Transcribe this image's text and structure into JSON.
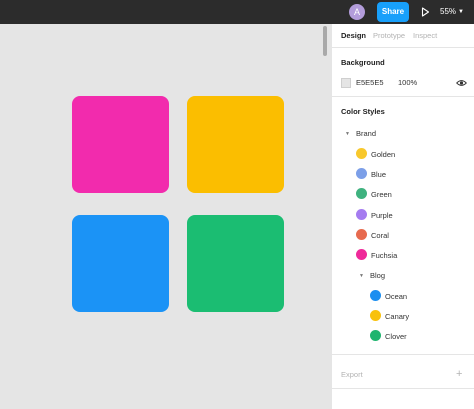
{
  "topbar": {
    "avatar_initial": "A",
    "share_label": "Share",
    "play_icon": "play-icon",
    "zoom": "55%",
    "colors": {
      "bar": "#2c2c2c",
      "share": "#18a0fb",
      "avatar": "#b39ddb"
    }
  },
  "canvas": {
    "background": "#E5E5E5",
    "swatches": [
      {
        "name": "Fuchsia",
        "color": "#f22bad"
      },
      {
        "name": "Golden",
        "color": "#fbbe00"
      },
      {
        "name": "Blue",
        "color": "#1b93f6"
      },
      {
        "name": "Green",
        "color": "#1bbd72"
      }
    ]
  },
  "panel": {
    "tabs": [
      {
        "label": "Design",
        "active": true
      },
      {
        "label": "Prototype",
        "active": false
      },
      {
        "label": "Inspect",
        "active": false
      }
    ],
    "background": {
      "title": "Background",
      "hex": "E5E5E5",
      "opacity": "100%",
      "visibility_icon": "eye-icon"
    },
    "color_styles": {
      "title": "Color Styles",
      "brand_label": "Brand",
      "brand_items": [
        {
          "label": "Golden",
          "color": "#f8c82c"
        },
        {
          "label": "Blue",
          "color": "#7c9fe8"
        },
        {
          "label": "Green",
          "color": "#3fb27f"
        },
        {
          "label": "Purple",
          "color": "#a57cf0"
        },
        {
          "label": "Coral",
          "color": "#e76a4f"
        },
        {
          "label": "Fuchsia",
          "color": "#ef2a9a"
        }
      ],
      "blog_label": "Blog",
      "blog_items": [
        {
          "label": "Ocean",
          "color": "#1b8ef0"
        },
        {
          "label": "Canary",
          "color": "#f8c10d"
        },
        {
          "label": "Clover",
          "color": "#1fb46e"
        }
      ]
    },
    "export": {
      "title": "Export",
      "add_icon": "plus-icon"
    }
  }
}
